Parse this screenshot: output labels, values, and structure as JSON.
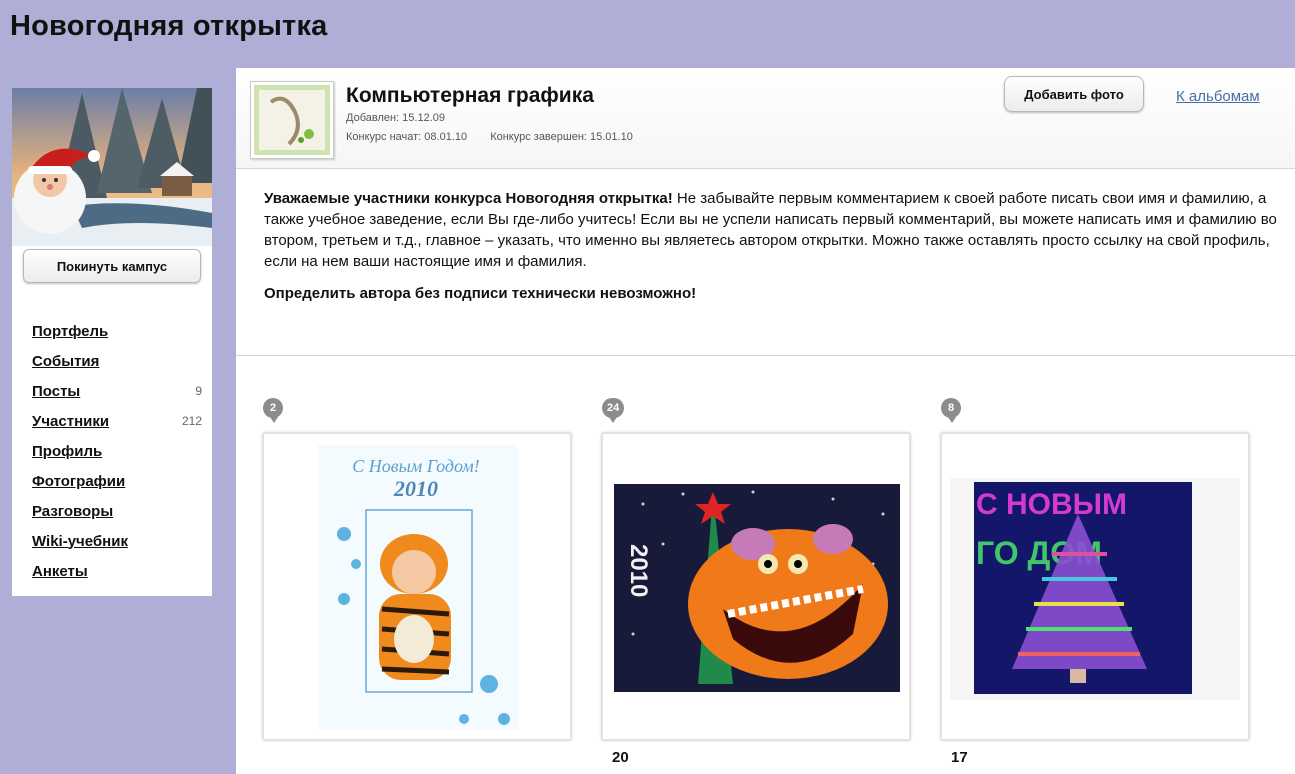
{
  "page": {
    "title": "Новогодняя открытка"
  },
  "sidebar": {
    "leave_button": "Покинуть кампус",
    "nav": [
      {
        "label": "Портфель",
        "count": ""
      },
      {
        "label": "События",
        "count": ""
      },
      {
        "label": "Посты",
        "count": "9"
      },
      {
        "label": "Участники",
        "count": "212"
      },
      {
        "label": "Профиль",
        "count": ""
      },
      {
        "label": "Фотографии",
        "count": ""
      },
      {
        "label": "Разговоры",
        "count": ""
      },
      {
        "label": "Wiki-учебник",
        "count": ""
      },
      {
        "label": "Анкеты",
        "count": ""
      }
    ]
  },
  "album": {
    "title": "Компьютерная графика",
    "added": "Добавлен: 15.12.09",
    "contest_start": "Конкурс начат: 08.01.10",
    "contest_end": "Конкурс завершен: 15.01.10",
    "add_photo_button": "Добавить фото",
    "to_albums_link": "К альбомам"
  },
  "notice": {
    "lead_bold": "Уважаемые участники конкурса Новогодняя открытка!",
    "text": " Не забывайте первым комментарием к своей работе писать свои имя и фамилию, а также учебное заведение, если Вы где-либо учитесь! Если вы не успели написать первый комментарий, вы можете написать имя и фамилию во втором, третьем и т.д., главное – указать, что именно вы являетесь автором открытки. Можно также оставлять просто ссылку на свой профиль, если на нем ваши настоящие имя и фамилия.",
    "warning": "Определить автора без подписи технически невозможно!"
  },
  "photos": [
    {
      "comments": "2",
      "votes": "",
      "card_title": "С Новым Годом!",
      "card_year": "2010"
    },
    {
      "comments": "24",
      "votes": "20",
      "card_year": "2010"
    },
    {
      "comments": "8",
      "votes": "17",
      "card_text_top": "С НОВЫМ",
      "card_text_bottom": "ГО ДОМ"
    }
  ],
  "colors": {
    "background": "#aeaed6",
    "link": "#4a6fa5",
    "badge": "#8c8c8c"
  }
}
